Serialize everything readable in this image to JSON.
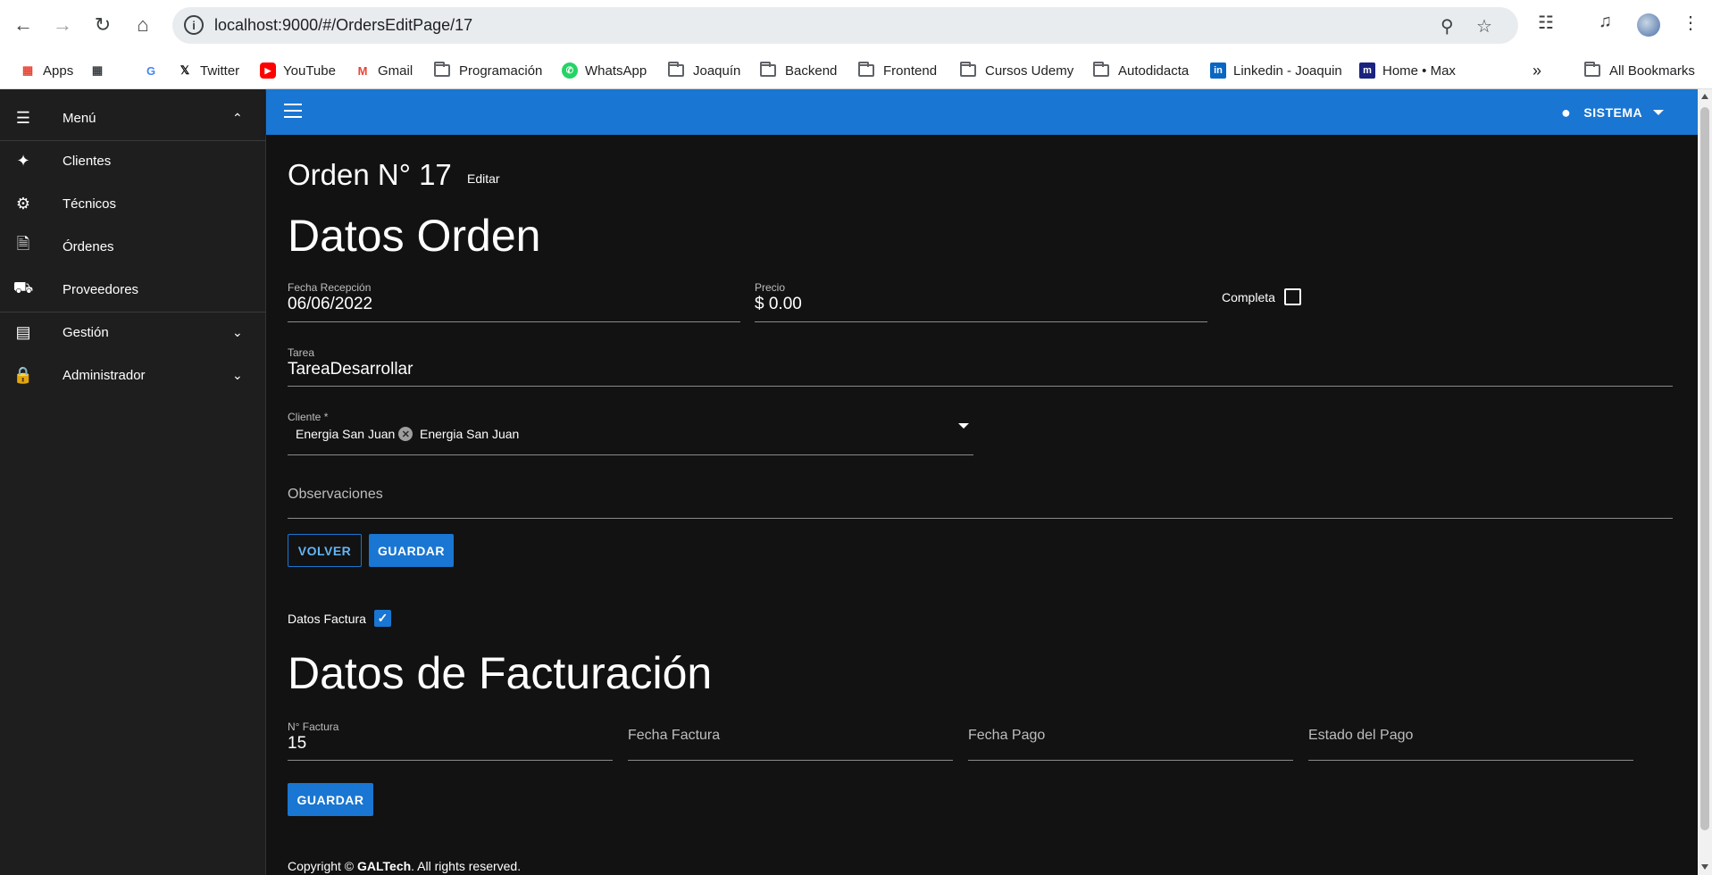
{
  "browser": {
    "url": "localhost:9000/#/OrdersEditPage/17",
    "bookmarks": [
      "Apps",
      "Twitter",
      "YouTube",
      "Gmail",
      "Programación",
      "WhatsApp",
      "Joaquín",
      "Backend",
      "Frontend",
      "Cursos Udemy",
      "Autodidacta",
      "Linkedin - Joaquin",
      "Home • Max"
    ],
    "all_bookmarks": "All Bookmarks"
  },
  "sidebar": {
    "menu_label": "Menú",
    "items": [
      {
        "label": "Clientes",
        "icon": "people-icon"
      },
      {
        "label": "Técnicos",
        "icon": "technicians-icon"
      },
      {
        "label": "Órdenes",
        "icon": "document-icon"
      },
      {
        "label": "Proveedores",
        "icon": "truck-icon"
      },
      {
        "label": "Gestión",
        "icon": "book-icon"
      },
      {
        "label": "Administrador",
        "icon": "lock-icon"
      }
    ]
  },
  "appbar": {
    "user_label": "SISTEMA"
  },
  "order": {
    "title": "Orden N° 17",
    "edit_label": "Editar",
    "section_title": "Datos Orden",
    "fecha_label": "Fecha Recepción",
    "fecha_value": "06/06/2022",
    "precio_label": "Precio",
    "precio_value": "$ 0.00",
    "completa_label": "Completa",
    "completa_checked": false,
    "tarea_label": "Tarea",
    "tarea_value": "TareaDesarrollar",
    "cliente_label": "Cliente *",
    "cliente_chip": "Energia San Juan",
    "cliente_value": "Energia San Juan",
    "observaciones_label": "Observaciones",
    "volver_label": "VOLVER",
    "guardar_label": "GUARDAR"
  },
  "factura": {
    "toggle_label": "Datos Factura",
    "toggle_checked": true,
    "section_title": "Datos de Facturación",
    "numero_label": "N° Factura",
    "numero_value": "15",
    "fecha_factura_label": "Fecha Factura",
    "fecha_pago_label": "Fecha Pago",
    "estado_label": "Estado del Pago",
    "guardar_label": "GUARDAR"
  },
  "footer": {
    "prefix": "Copyright © ",
    "brand": "GALTech",
    "suffix": ". All rights reserved."
  },
  "colors": {
    "primary": "#1976d2",
    "background": "#121212",
    "sidebar": "#1e1e1e"
  }
}
